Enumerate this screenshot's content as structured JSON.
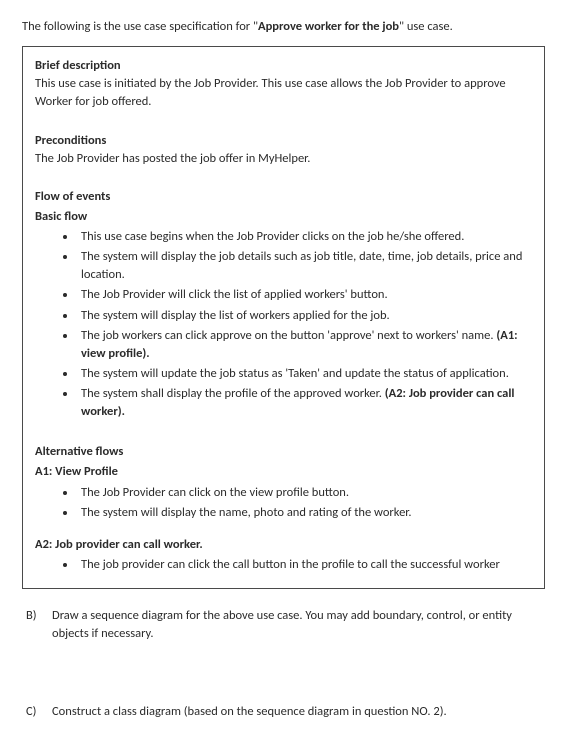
{
  "intro": {
    "prefix": "The following is the use case specification for \"",
    "bold_title": "Approve worker for the job",
    "suffix": "\" use case."
  },
  "brief": {
    "heading": "Brief description",
    "text": "This use case is initiated by the Job Provider. This use case allows the Job Provider to approve Worker for job offered."
  },
  "preconditions": {
    "heading": "Preconditions",
    "text": "The Job Provider has posted the job offer in MyHelper."
  },
  "flow": {
    "heading": "Flow of events",
    "basic_flow_heading": "Basic flow",
    "basic_items": [
      {
        "text": "This use case begins when the Job Provider clicks on the job he/she offered."
      },
      {
        "text": "The system will display the job details such as job title, date, time, job details, price and location."
      },
      {
        "text": "The Job Provider will click the list of applied workers' button."
      },
      {
        "text": "The system will display the list of workers applied for the job."
      },
      {
        "text": "The job workers can click approve on the button 'approve' next to workers' name. ",
        "bold_tail": "(A1: view profile)."
      },
      {
        "text": "The system will update the job status as 'Taken' and update the status of application."
      },
      {
        "text": "The system shall display the profile of the approved worker. ",
        "bold_tail": "(A2: Job provider can call worker)."
      }
    ]
  },
  "alt": {
    "heading": "Alternative flows",
    "a1_heading": "A1: View Profile",
    "a1_items": [
      "The Job Provider can click on the view profile button.",
      "The system will display the name, photo and rating of the worker."
    ],
    "a2_heading": "A2: Job provider can call worker.",
    "a2_items": [
      "The job provider can click the call button in the profile to call the successful worker"
    ]
  },
  "questions": {
    "b_marker": "B)",
    "b_text": "Draw a sequence diagram for the above use case. You may add boundary, control, or entity objects if necessary.",
    "c_marker": "C)",
    "c_text": "Construct a class diagram (based on the sequence diagram in question NO. 2)."
  }
}
